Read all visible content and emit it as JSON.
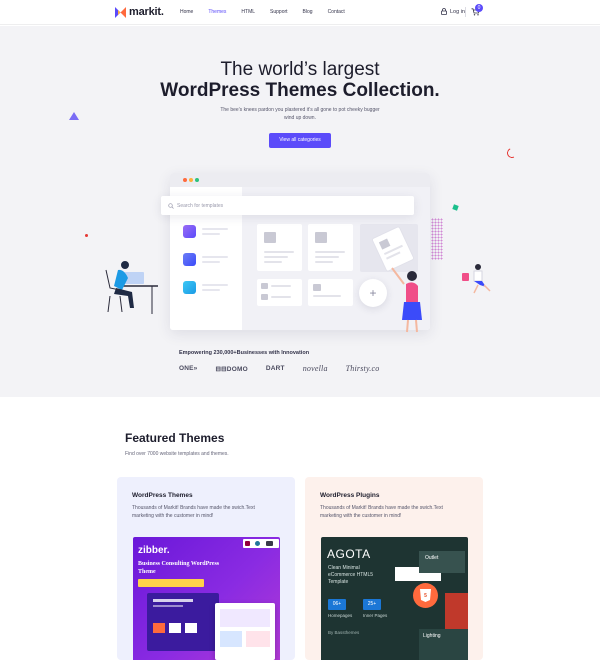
{
  "nav": {
    "logo_text": "markit.",
    "menu": [
      {
        "label": "Home"
      },
      {
        "label": "Themes",
        "active": true
      },
      {
        "label": "HTML"
      },
      {
        "label": "Support"
      },
      {
        "label": "Blog"
      },
      {
        "label": "Contact"
      }
    ],
    "login_label": "Log in",
    "cart_count": "0"
  },
  "hero": {
    "title_line1": "The world’s largest",
    "title_line2": "WordPress Themes Collection.",
    "subtitle": "The bee’s knees pardon you plastered it’s all gone to pot cheeky bugger wind up down.",
    "cta_label": "View all categories",
    "search_placeholder": "Search for templates",
    "empower_text": "Empowering 230,000+Businesses with Innovation",
    "brands": [
      "ONE»",
      "⊟⊟DOMO",
      "DART",
      "novella",
      "Thirsty.co"
    ]
  },
  "featured": {
    "title": "Featured Themes",
    "subtitle": "Find over 7000 website templates and themes.",
    "panels": [
      {
        "title": "WordPress Themes",
        "desc": "Thousands of Markit! Brands have made the swich.Text marketing with the customer in mind!",
        "shot_brand": "zibber.",
        "shot_heading": "Business Consulting WordPress Theme"
      },
      {
        "title": "WordPress Plugins",
        "desc": "Thousands of Markit! Brands have made the swich.Text marketing with the customer in mind!",
        "shot_brand": "AGOTA",
        "shot_heading": "Clean Minimal eCommerce HTML5 Template",
        "stat1_value": "06+",
        "stat1_label": "Homepages",
        "stat2_value": "25+",
        "stat2_label": "Inner Pages",
        "shot_author": "By Bassthemes",
        "shot_tag1": "Outlet",
        "shot_tag2": "Lighting"
      }
    ]
  },
  "colors": {
    "accent": "#5b4bfa",
    "hero_bg": "#f3f3f6",
    "panel1_bg": "#eef0fd",
    "panel2_bg": "#fdf1ec"
  }
}
